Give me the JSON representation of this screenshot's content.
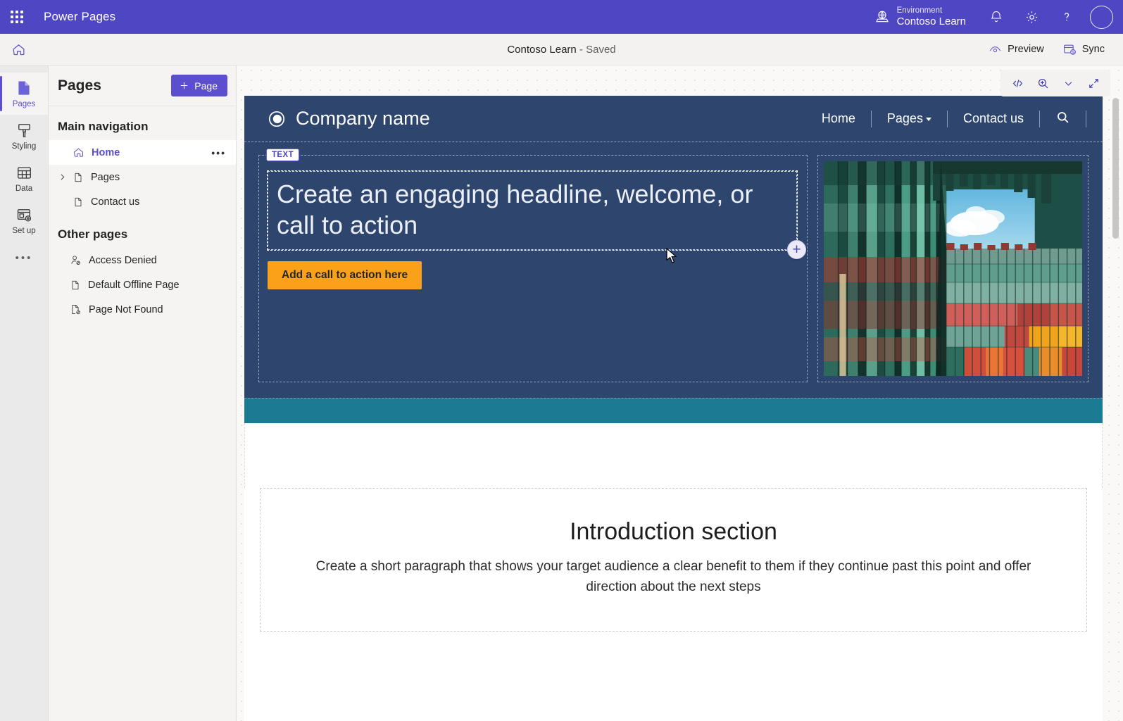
{
  "appbar": {
    "waffle_icon": "app-launcher-icon",
    "title": "Power Pages",
    "environment_label": "Environment",
    "environment_name": "Contoso Learn",
    "notifications_icon": "bell-icon",
    "settings_icon": "gear-icon",
    "help_icon": "question-mark-icon",
    "avatar_icon": "user-avatar",
    "accent_color": "#4f46c4"
  },
  "commandbar": {
    "home_icon": "home-icon",
    "doc_title": "Contoso Learn",
    "doc_separator": " - ",
    "doc_status": "Saved",
    "preview_label": "Preview",
    "preview_icon": "eye-icon",
    "sync_label": "Sync",
    "sync_icon": "sync-database-icon"
  },
  "rail": {
    "items": [
      {
        "label": "Pages",
        "icon": "pages-icon",
        "active": true
      },
      {
        "label": "Styling",
        "icon": "paint-brush-icon",
        "active": false
      },
      {
        "label": "Data",
        "icon": "table-icon",
        "active": false
      },
      {
        "label": "Set up",
        "icon": "setup-gear-icon",
        "active": false
      }
    ],
    "more_label": "•••"
  },
  "panel": {
    "title": "Pages",
    "add_button_label": "Page",
    "add_button_icon": "plus-icon",
    "main_nav_heading": "Main navigation",
    "main_nav_items": [
      {
        "label": "Home",
        "icon": "home-icon",
        "selected": true,
        "expandable": false,
        "overflow": "•••"
      },
      {
        "label": "Pages",
        "icon": "page-icon",
        "selected": false,
        "expandable": true
      },
      {
        "label": "Contact us",
        "icon": "page-icon",
        "selected": false,
        "expandable": false
      }
    ],
    "other_pages_heading": "Other pages",
    "other_pages_items": [
      {
        "label": "Access Denied",
        "icon": "user-blocked-icon"
      },
      {
        "label": "Default Offline Page",
        "icon": "page-icon"
      },
      {
        "label": "Page Not Found",
        "icon": "page-blocked-icon"
      }
    ]
  },
  "canvas_toolbar": {
    "code_icon": "code-brackets-icon",
    "zoom_icon": "zoom-in-icon",
    "zoom_chevron_icon": "chevron-down-icon",
    "expand_icon": "expand-diagonal-icon"
  },
  "site": {
    "header": {
      "logo_icon": "circle-logo-icon",
      "brand": "Company name",
      "nav": [
        {
          "label": "Home",
          "dropdown": false
        },
        {
          "label": "Pages",
          "dropdown": true
        },
        {
          "label": "Contact us",
          "dropdown": false
        }
      ],
      "search_icon": "search-icon",
      "background_color": "#2e456e"
    },
    "hero": {
      "badge": "TEXT",
      "headline": "Create an engaging headline, welcome, or call to action",
      "cta_label": "Add a call to action here",
      "cta_color": "#fba119",
      "add_handle_icon": "plus-circle-icon",
      "image_alt": "stacked-shipping-containers-photo",
      "background_color": "#2e456e"
    },
    "band_color": "#1a7b92",
    "intro": {
      "title": "Introduction section",
      "body": "Create a short paragraph that shows your target audience a clear benefit to them if they continue past this point and offer direction about the next steps"
    }
  }
}
